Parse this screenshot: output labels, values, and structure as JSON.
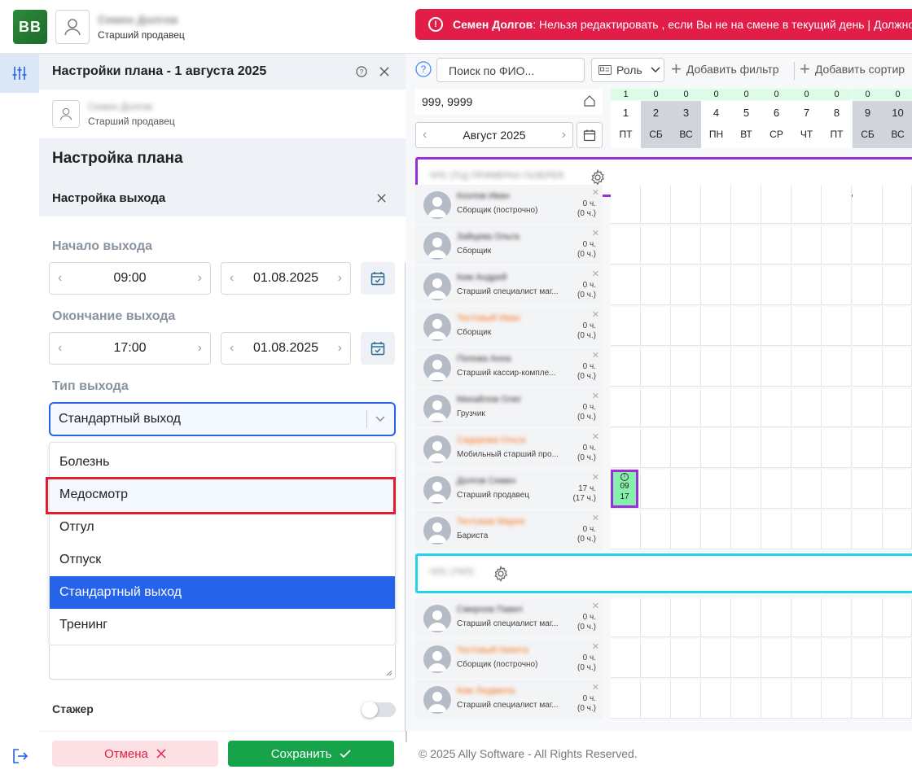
{
  "header": {
    "user_name": "Семен Долгов",
    "user_role": "Старший продавец",
    "logo_text": "BB",
    "alert_name": "Семен Долгов",
    "alert_text": ": Нельзя редактировать , если Вы не на смене в текущий день | Должно"
  },
  "panel": {
    "title": "Настройки плана - 1 августа 2025",
    "user_name": "Семен Долгов",
    "user_role": "Старший продавец",
    "section_title": "Настройка плана",
    "subsection_title": "Настройка выхода",
    "start_label": "Начало выхода",
    "start_time": "09:00",
    "start_date": "01.08.2025",
    "end_label": "Окончание выхода",
    "end_time": "17:00",
    "end_date": "01.08.2025",
    "type_label": "Тип выхода",
    "type_value": "Стандартный выход",
    "options": [
      "Болезнь",
      "Медосмотр",
      "Отгул",
      "Отпуск",
      "Стандартный выход",
      "Тренинг"
    ],
    "trainee_label": "Стажер",
    "cancel_label": "Отмена",
    "save_label": "Сохранить"
  },
  "toolbar": {
    "search_placeholder": "Поиск по ФИО...",
    "role_label": "Роль",
    "add_filter_label": "Добавить фильтр",
    "add_sort_label": "Добавить сортир"
  },
  "table": {
    "store_label": "999, 9999",
    "month_label": "Август 2025",
    "days": [
      {
        "count": "1",
        "num": "1",
        "dow": "ПТ",
        "weekend": false
      },
      {
        "count": "0",
        "num": "2",
        "dow": "СБ",
        "weekend": true
      },
      {
        "count": "0",
        "num": "3",
        "dow": "ВС",
        "weekend": true
      },
      {
        "count": "0",
        "num": "4",
        "dow": "ПН",
        "weekend": false
      },
      {
        "count": "0",
        "num": "5",
        "dow": "ВТ",
        "weekend": false
      },
      {
        "count": "0",
        "num": "6",
        "dow": "СР",
        "weekend": false
      },
      {
        "count": "0",
        "num": "7",
        "dow": "ЧТ",
        "weekend": false
      },
      {
        "count": "0",
        "num": "8",
        "dow": "ПТ",
        "weekend": false
      },
      {
        "count": "0",
        "num": "9",
        "dow": "СБ",
        "weekend": true
      },
      {
        "count": "0",
        "num": "10",
        "dow": "ВС",
        "weekend": true
      }
    ],
    "group1_name": "ЧПС (ТЦ) ПРИМЕРКА ГАЛЕРЕЯ",
    "group2_name": "ЧПС (ТКП)",
    "employees": [
      {
        "name": "Козлов Иван",
        "role": "Сборщик (построчно)",
        "hours": "0 ч.",
        "hours2": "(0 ч.)",
        "warn": false
      },
      {
        "name": "Зайцева Ольга",
        "role": "Сборщик",
        "hours": "0 ч.",
        "hours2": "(0 ч.)",
        "warn": false
      },
      {
        "name": "Ким Андрей",
        "role": "Старший специалист маг...",
        "hours": "0 ч.",
        "hours2": "(0 ч.)",
        "warn": false
      },
      {
        "name": "Тестовый Иван",
        "role": "Сборщик",
        "hours": "0 ч.",
        "hours2": "(0 ч.)",
        "warn": true
      },
      {
        "name": "Попова Анна",
        "role": "Старший кассир-компле...",
        "hours": "0 ч.",
        "hours2": "(0 ч.)",
        "warn": false
      },
      {
        "name": "Михайлов Олег",
        "role": "Грузчик",
        "hours": "0 ч.",
        "hours2": "(0 ч.)",
        "warn": false
      },
      {
        "name": "Сидорова Ольга",
        "role": "Мобильный старший про...",
        "hours": "0 ч.",
        "hours2": "(0 ч.)",
        "warn": true
      },
      {
        "name": "Долгов Семен",
        "role": "Старший продавец",
        "hours": "17 ч.",
        "hours2": "(17 ч.)",
        "warn": false
      },
      {
        "name": "Тестовая Мария",
        "role": "Бариста",
        "hours": "0 ч.",
        "hours2": "(0 ч.)",
        "warn": true
      }
    ],
    "employees2": [
      {
        "name": "Смирнов Павел",
        "role": "Старший специалист маг...",
        "hours": "0 ч.",
        "hours2": "(0 ч.)",
        "warn": false
      },
      {
        "name": "Тестовый Никита",
        "role": "Сборщик (построчно)",
        "hours": "0 ч.",
        "hours2": "(0 ч.)",
        "warn": true
      },
      {
        "name": "Ким Людмила",
        "role": "Старший специалист маг...",
        "hours": "0 ч.",
        "hours2": "(0 ч.)",
        "warn": true
      }
    ],
    "shift": {
      "start": "09",
      "end": "17"
    }
  },
  "footer": {
    "copyright": "© 2025 Ally Software - All Rights Reserved."
  },
  "colors": {
    "accent": "#2563eb",
    "danger": "#e11d48",
    "save": "#16a34a",
    "group1_border": "#9b30d9",
    "group2_border": "#22d3ee",
    "shift_bg": "#86efac"
  }
}
